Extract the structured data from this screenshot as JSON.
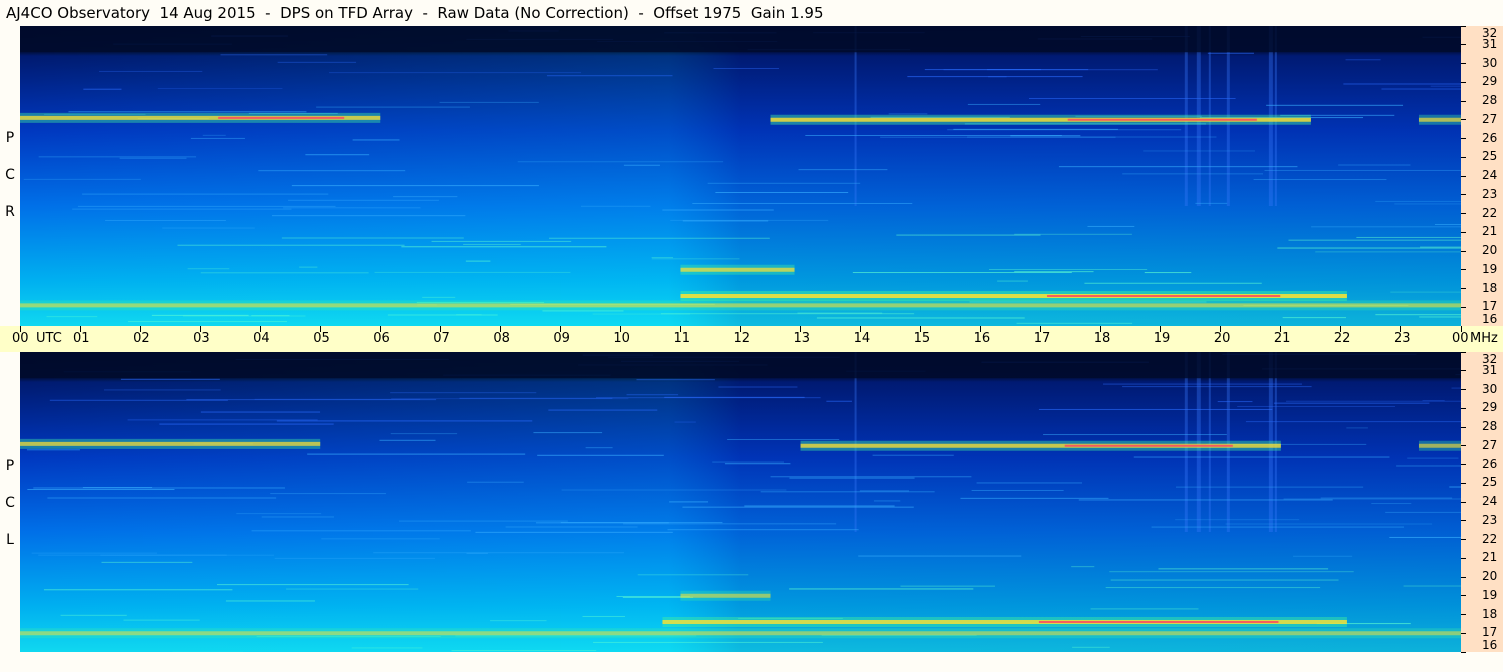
{
  "header": {
    "title": "AJ4CO Observatory  14 Aug 2015  -  DPS on TFD Array  -  Raw Data (No Correction)  -  Offset 1975  Gain 1.95"
  },
  "chart_data": [
    {
      "type": "heatmap",
      "panel": "top",
      "ylabel": "R C P",
      "ylabel_letters": [
        "R",
        "C",
        "P"
      ],
      "y_unit": "MHz",
      "ylim": [
        16,
        32
      ],
      "y_ticks": [
        32,
        31,
        30,
        29,
        28,
        27,
        26,
        25,
        24,
        23,
        22,
        21,
        20,
        19,
        18,
        17,
        16
      ],
      "xlim": [
        0,
        24
      ],
      "x_unit": "UTC",
      "x_ticks": [
        "00",
        "01",
        "02",
        "03",
        "04",
        "05",
        "06",
        "07",
        "08",
        "09",
        "10",
        "11",
        "12",
        "13",
        "14",
        "15",
        "16",
        "17",
        "18",
        "19",
        "20",
        "21",
        "22",
        "23",
        "00"
      ],
      "bright_bands": [
        {
          "freq_mhz": 27.1,
          "start_utc": 0,
          "end_utc": 6.0,
          "intensity": 0.75
        },
        {
          "freq_mhz": 27.0,
          "start_utc": 12.5,
          "end_utc": 21.5,
          "intensity": 0.8
        },
        {
          "freq_mhz": 27.0,
          "start_utc": 23.3,
          "end_utc": 24,
          "intensity": 0.65
        },
        {
          "freq_mhz": 17.6,
          "start_utc": 11.0,
          "end_utc": 22.1,
          "intensity": 0.85
        },
        {
          "freq_mhz": 19.0,
          "start_utc": 11.0,
          "end_utc": 12.9,
          "intensity": 0.7
        },
        {
          "freq_mhz": 17.1,
          "start_utc": 0,
          "end_utc": 24,
          "intensity": 0.55
        }
      ]
    },
    {
      "type": "heatmap",
      "panel": "bottom",
      "ylabel": "L C P",
      "ylabel_letters": [
        "L",
        "C",
        "P"
      ],
      "y_unit": "MHz",
      "ylim": [
        16,
        32
      ],
      "y_ticks": [
        32,
        31,
        30,
        29,
        28,
        27,
        26,
        25,
        24,
        23,
        22,
        21,
        20,
        19,
        18,
        17,
        16
      ],
      "xlim": [
        0,
        24
      ],
      "x_unit": "UTC",
      "x_ticks": [
        "00",
        "01",
        "02",
        "03",
        "04",
        "05",
        "06",
        "07",
        "08",
        "09",
        "10",
        "11",
        "12",
        "13",
        "14",
        "15",
        "16",
        "17",
        "18",
        "19",
        "20",
        "21",
        "22",
        "23",
        "00"
      ],
      "bright_bands": [
        {
          "freq_mhz": 27.1,
          "start_utc": 0,
          "end_utc": 5.0,
          "intensity": 0.7
        },
        {
          "freq_mhz": 27.0,
          "start_utc": 13.0,
          "end_utc": 21.0,
          "intensity": 0.75
        },
        {
          "freq_mhz": 27.0,
          "start_utc": 23.3,
          "end_utc": 24,
          "intensity": 0.6
        },
        {
          "freq_mhz": 17.6,
          "start_utc": 10.7,
          "end_utc": 22.1,
          "intensity": 0.8
        },
        {
          "freq_mhz": 19.0,
          "start_utc": 11.0,
          "end_utc": 12.5,
          "intensity": 0.55
        },
        {
          "freq_mhz": 17.0,
          "start_utc": 0,
          "end_utc": 24,
          "intensity": 0.5
        }
      ]
    }
  ],
  "axis": {
    "utc_label": "UTC",
    "mhz_label": "MHz"
  },
  "colors": {
    "background": "#fffdf6",
    "time_axis_bg": "#ffffc8",
    "freq_axis_bg": "#ffe0c4",
    "low": "#000a3a",
    "mid": "#0050e0",
    "high": "#00e0ff",
    "peak": "#ffff00"
  }
}
